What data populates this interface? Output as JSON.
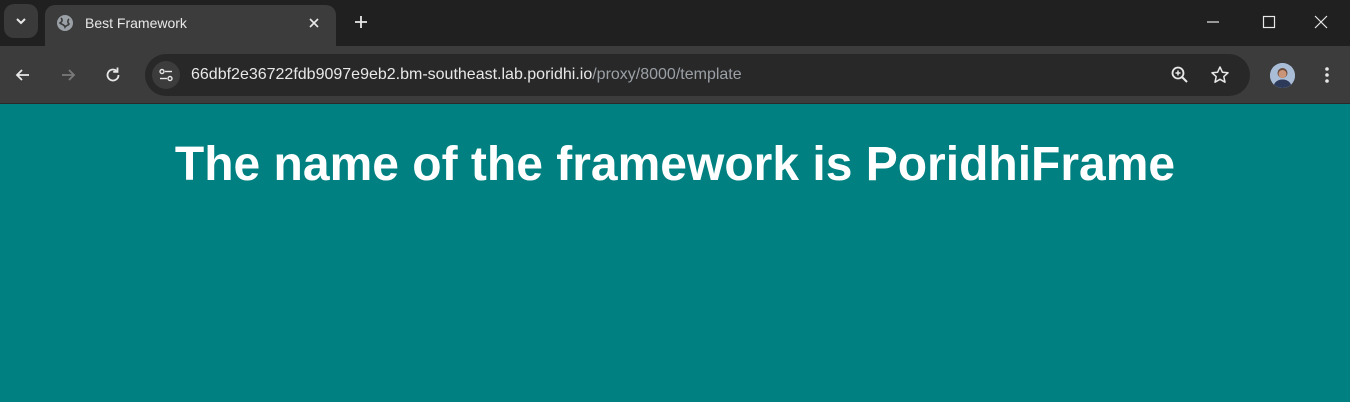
{
  "browser": {
    "tab": {
      "title": "Best Framework",
      "favicon": "globe-icon"
    },
    "window_controls": [
      "minimize-icon",
      "maximize-icon",
      "close-icon"
    ],
    "address_bar": {
      "host": "66dbf2e36722fdb9097e9eb2.bm-southeast.lab.poridhi.io",
      "path": "/proxy/8000/template"
    },
    "colors": {
      "tabstrip": "#202020",
      "toolbar": "#3c3c3c",
      "omnibox": "#282828"
    }
  },
  "page": {
    "heading": "The name of the framework is PoridhiFrame",
    "background_color": "#008080",
    "text_color": "#ffffff"
  }
}
